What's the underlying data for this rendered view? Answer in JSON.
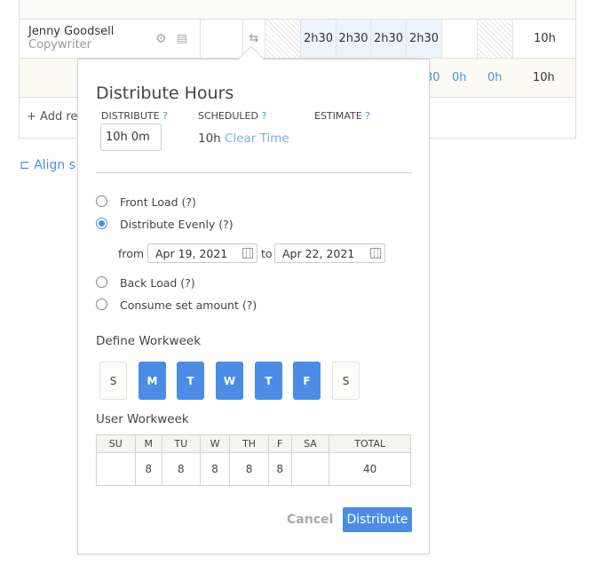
{
  "background": {
    "resource": {
      "name": "Jenny Goodsell",
      "role": "Copywriter",
      "icons": [
        "gear-icon",
        "calculator-icon",
        "distribute-arrows-icon"
      ]
    },
    "hours": [
      "2h30",
      "2h30",
      "2h30",
      "2h30"
    ],
    "total": "10h",
    "row2": {
      "partial": "30",
      "v1": "0h",
      "v2": "0h",
      "total": "10h"
    },
    "add_resource": "+ Add res",
    "align": "Align s"
  },
  "popup": {
    "title": "Distribute Hours",
    "distribute_label": "DISTRIBUTE",
    "scheduled_label": "SCHEDULED",
    "estimate_label": "ESTIMATE",
    "help": "?",
    "distribute_value": "10h 0m",
    "scheduled_value": "10h",
    "clear_time": "Clear Time",
    "options": [
      {
        "label": "Front Load (?)",
        "selected": false
      },
      {
        "label": "Distribute Evenly (?)",
        "selected": true
      },
      {
        "label": "Back Load (?)",
        "selected": false
      },
      {
        "label": "Consume set amount (?)",
        "selected": false
      }
    ],
    "from_label": "from",
    "to_label": "to",
    "from_date": "Apr 19, 2021",
    "to_date": "Apr 22, 2021",
    "define_workweek": "Define Workweek",
    "days": [
      {
        "l": "S",
        "on": false
      },
      {
        "l": "M",
        "on": true
      },
      {
        "l": "T",
        "on": true
      },
      {
        "l": "W",
        "on": true
      },
      {
        "l": "T",
        "on": true
      },
      {
        "l": "F",
        "on": true
      },
      {
        "l": "S",
        "on": false
      }
    ],
    "user_workweek": "User Workweek",
    "headers": [
      "SU",
      "M",
      "TU",
      "W",
      "TH",
      "F",
      "SA",
      "TOTAL"
    ],
    "values": [
      "",
      "8",
      "8",
      "8",
      "8",
      "8",
      "",
      "40"
    ],
    "cancel": "Cancel",
    "distribute": "Distribute",
    "accent": "#4a8ce6"
  }
}
